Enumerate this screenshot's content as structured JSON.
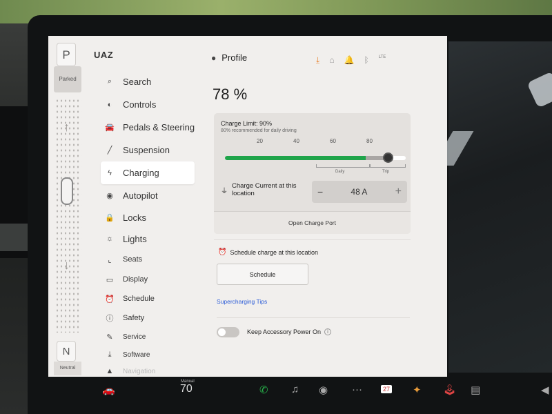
{
  "gear": {
    "park": "P",
    "park_label": "Parked",
    "neutral": "N",
    "neutral_label": "Neutral",
    "up_arrow": "↑",
    "down_arrow": "↓"
  },
  "sidebar": {
    "brand": "UAZ",
    "items": [
      {
        "label": "Search",
        "icon": "search-icon",
        "glyph": "⌕"
      },
      {
        "label": "Controls",
        "icon": "toggle-icon",
        "glyph": "◐"
      },
      {
        "label": "Pedals & Steering",
        "icon": "car-icon",
        "glyph": "🚘"
      },
      {
        "label": "Suspension",
        "icon": "wrench-icon",
        "glyph": "╱"
      },
      {
        "label": "Charging",
        "icon": "lightning-icon",
        "glyph": "ϟ",
        "active": true
      },
      {
        "label": "Autopilot",
        "icon": "steering-icon",
        "glyph": "◉"
      },
      {
        "label": "Locks",
        "icon": "lock-icon",
        "glyph": "🔒"
      },
      {
        "label": "Lights",
        "icon": "sun-icon",
        "glyph": "☼"
      },
      {
        "label": "Seats",
        "icon": "seat-icon",
        "glyph": "⌞"
      },
      {
        "label": "Display",
        "icon": "display-icon",
        "glyph": "▭"
      },
      {
        "label": "Schedule",
        "icon": "alarm-icon",
        "glyph": "⏰"
      },
      {
        "label": "Safety",
        "icon": "info-icon",
        "glyph": "ⓘ"
      },
      {
        "label": "Service",
        "icon": "wrench-icon",
        "glyph": "✎"
      },
      {
        "label": "Software",
        "icon": "download-icon",
        "glyph": "⤓"
      },
      {
        "label": "Navigation",
        "icon": "navigation-icon",
        "glyph": "▲"
      }
    ]
  },
  "header": {
    "profile_label": "Profile",
    "icons": [
      "download-icon",
      "home-icon",
      "bell-icon",
      "bluetooth-icon",
      "lte-signal-icon"
    ],
    "lte": "LTE"
  },
  "charging": {
    "battery_percent": "78 %",
    "limit_title": "Charge Limit: 90%",
    "limit_note": "80% recommended for daily driving",
    "limit_value": 90,
    "ticks": [
      "20",
      "40",
      "60",
      "80"
    ],
    "zone_daily": "Daily",
    "zone_trip": "Trip",
    "current_label": "Charge Current at this location",
    "current_value": "48 A",
    "minus": "−",
    "plus": "+",
    "open_port": "Open Charge Port",
    "schedule_heading": "Schedule charge at this location",
    "schedule_button": "Schedule",
    "tips_link": "Supercharging Tips",
    "accessory_label": "Keep Accessory Power On",
    "accessory_on": false
  },
  "dock": {
    "speed_label": "Manual",
    "speed": "70",
    "calendar_day": "27"
  },
  "colors": {
    "accent_green": "#1fa44a",
    "link_blue": "#2a5bd7",
    "download_orange": "#e8802a"
  }
}
